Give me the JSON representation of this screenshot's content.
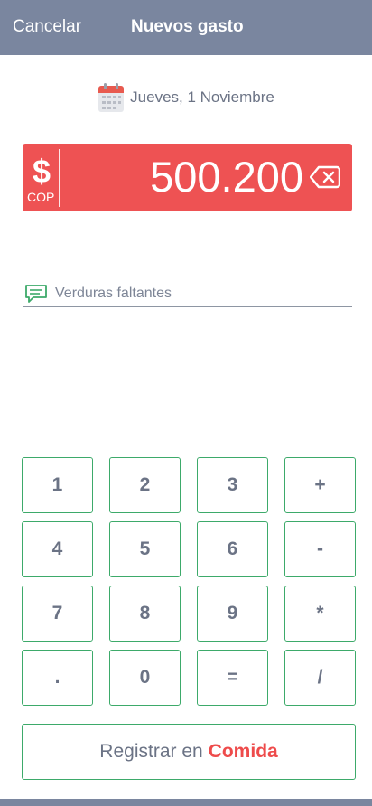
{
  "header": {
    "cancel_label": "Cancelar",
    "title": "Nuevos gasto"
  },
  "date": {
    "icon": "calendar-icon",
    "label": "Jueves, 1 Noviembre"
  },
  "amount": {
    "currency_symbol": "$",
    "currency_code": "COP",
    "value": "500.200",
    "backspace_icon": "backspace-icon",
    "color": "#ee5253"
  },
  "note": {
    "icon": "comment-icon",
    "placeholder": "Verduras faltantes"
  },
  "keypad": {
    "row1": [
      "1",
      "2",
      "3",
      "+"
    ],
    "row2": [
      "4",
      "5",
      "6",
      "-"
    ],
    "row3": [
      "7",
      "8",
      "9",
      "*"
    ],
    "row4": [
      ".",
      "0",
      "=",
      "/"
    ],
    "border_color": "#3daa6a"
  },
  "register": {
    "prefix": "Registrar en",
    "category": "Comida",
    "category_color": "#ee4b4b"
  },
  "header_color": "#7a869f"
}
